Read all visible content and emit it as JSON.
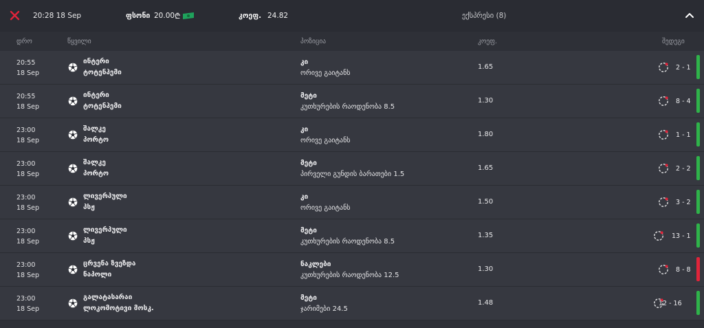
{
  "header": {
    "time": "20:28 18 Sep",
    "stake_label": "ფსონი",
    "stake_value": "20.00",
    "currency": "₾",
    "coef_label": "კოეფ.",
    "coef_value": "24.82",
    "bet_type": "ექსპრესი (8)"
  },
  "columns": {
    "date": "დრო",
    "pair": "წყვილი",
    "position": "პოზიცია",
    "coef": "კოეფ.",
    "results": "შედეგი"
  },
  "colors": {
    "win": "#2fb34a",
    "lose": "#e0243a",
    "close": "#e0243a",
    "money": "#1fa35c"
  },
  "rows": [
    {
      "time": "20:55",
      "date": "18 Sep",
      "team1": "ინტერი",
      "team2": "ტოტენჰემი",
      "pick": "კი",
      "market": "ორივე გაიტანს",
      "odd": "1.65",
      "score": "2 - 1",
      "status": "win"
    },
    {
      "time": "20:55",
      "date": "18 Sep",
      "team1": "ინტერი",
      "team2": "ტოტენჰემი",
      "pick": "მეტი",
      "market": "კუთხურების რაოდენობა 8.5",
      "odd": "1.30",
      "score": "8 - 4",
      "status": "win"
    },
    {
      "time": "23:00",
      "date": "18 Sep",
      "team1": "შალკე",
      "team2": "პორტო",
      "pick": "კი",
      "market": "ორივე გაიტანს",
      "odd": "1.80",
      "score": "1 - 1",
      "status": "win"
    },
    {
      "time": "23:00",
      "date": "18 Sep",
      "team1": "შალკე",
      "team2": "პორტო",
      "pick": "მეტი",
      "market": "პირველი გუნდის ბარათები 1.5",
      "odd": "1.65",
      "score": "2 - 2",
      "status": "win"
    },
    {
      "time": "23:00",
      "date": "18 Sep",
      "team1": "ლივერპული",
      "team2": "პსჟ",
      "pick": "კი",
      "market": "ორივე გაიტანს",
      "odd": "1.50",
      "score": "3 - 2",
      "status": "win"
    },
    {
      "time": "23:00",
      "date": "18 Sep",
      "team1": "ლივერპული",
      "team2": "პსჟ",
      "pick": "მეტი",
      "market": "კუთხურების რაოდენობა 8.5",
      "odd": "1.35",
      "score": "13 - 1",
      "status": "win"
    },
    {
      "time": "23:00",
      "date": "18 Sep",
      "team1": "ცრვენა ზვეზდა",
      "team2": "ნაპოლი",
      "pick": "ნაკლები",
      "market": "კუთხურების რაოდენობა 12.5",
      "odd": "1.30",
      "score": "8 - 8",
      "status": "lose"
    },
    {
      "time": "23:00",
      "date": "18 Sep",
      "team1": "გალატასარაი",
      "team2": "ლოკომოტივი მოსკ.",
      "pick": "მეტი",
      "market": "ჯარიმები 24.5",
      "odd": "1.48",
      "score": "12 - 16",
      "status": "win"
    }
  ]
}
